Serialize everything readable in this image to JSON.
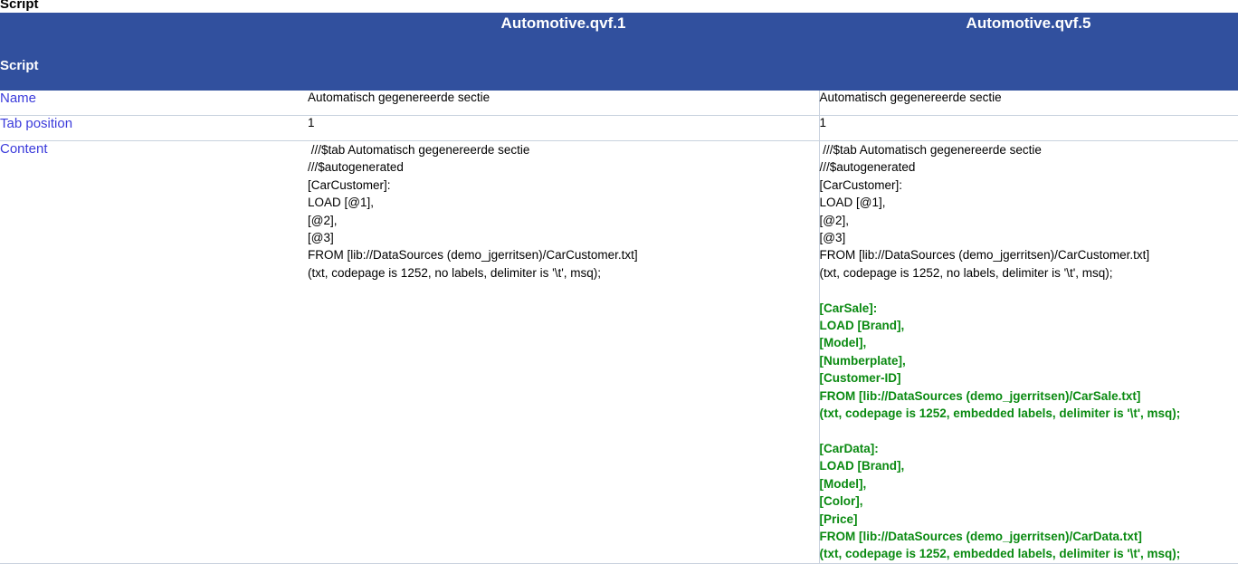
{
  "page": {
    "title": "Script"
  },
  "header": {
    "corner": "",
    "files": [
      "Automotive.qvf.1",
      "Automotive.qvf.5"
    ]
  },
  "section": {
    "label": "Script"
  },
  "colors": {
    "header_blue": "#31509E",
    "label_blue": "#3B3BDB",
    "added_green": "#0A8A11",
    "grid_line": "#C9D2DE",
    "text_black": "#000000",
    "background": "#FFFFFF"
  },
  "rows": [
    {
      "label": "Name",
      "values": [
        "Automatisch gegenereerde sectie",
        "Automatisch gegenereerde sectie"
      ]
    },
    {
      "label": "Tab position",
      "values": [
        "1",
        "1"
      ]
    }
  ],
  "content_row": {
    "label": "Content",
    "col1": [
      {
        "text": " ///$tab Automatisch gegenereerde sectie",
        "style": "normal"
      },
      {
        "text": "///$autogenerated",
        "style": "normal"
      },
      {
        "text": "[CarCustomer]:",
        "style": "normal"
      },
      {
        "text": "LOAD [@1],",
        "style": "normal"
      },
      {
        "text": "[@2],",
        "style": "normal"
      },
      {
        "text": "[@3]",
        "style": "normal"
      },
      {
        "text": "FROM [lib://DataSources (demo_jgerritsen)/CarCustomer.txt]",
        "style": "normal"
      },
      {
        "text": "(txt, codepage is 1252, no labels, delimiter is '\\t', msq);",
        "style": "normal"
      }
    ],
    "col2": [
      {
        "text": " ///$tab Automatisch gegenereerde sectie",
        "style": "normal"
      },
      {
        "text": "///$autogenerated",
        "style": "normal"
      },
      {
        "text": "[CarCustomer]:",
        "style": "normal"
      },
      {
        "text": "LOAD [@1],",
        "style": "normal"
      },
      {
        "text": "[@2],",
        "style": "normal"
      },
      {
        "text": "[@3]",
        "style": "normal"
      },
      {
        "text": "FROM [lib://DataSources (demo_jgerritsen)/CarCustomer.txt]",
        "style": "normal"
      },
      {
        "text": "(txt, codepage is 1252, no labels, delimiter is '\\t', msq);",
        "style": "normal"
      },
      {
        "text": "",
        "style": "blank"
      },
      {
        "text": "[CarSale]:",
        "style": "green"
      },
      {
        "text": "LOAD [Brand],",
        "style": "green"
      },
      {
        "text": "[Model],",
        "style": "green"
      },
      {
        "text": "[Numberplate],",
        "style": "green"
      },
      {
        "text": "[Customer-ID]",
        "style": "green"
      },
      {
        "text": "FROM [lib://DataSources (demo_jgerritsen)/CarSale.txt]",
        "style": "green"
      },
      {
        "text": "(txt, codepage is 1252, embedded labels, delimiter is '\\t', msq);",
        "style": "green"
      },
      {
        "text": "",
        "style": "blank"
      },
      {
        "text": "[CarData]:",
        "style": "green"
      },
      {
        "text": "LOAD [Brand],",
        "style": "green"
      },
      {
        "text": "[Model],",
        "style": "green"
      },
      {
        "text": "[Color],",
        "style": "green"
      },
      {
        "text": "[Price]",
        "style": "green"
      },
      {
        "text": "FROM [lib://DataSources (demo_jgerritsen)/CarData.txt]",
        "style": "green"
      },
      {
        "text": "(txt, codepage is 1252, embedded labels, delimiter is '\\t', msq);",
        "style": "green"
      }
    ]
  }
}
